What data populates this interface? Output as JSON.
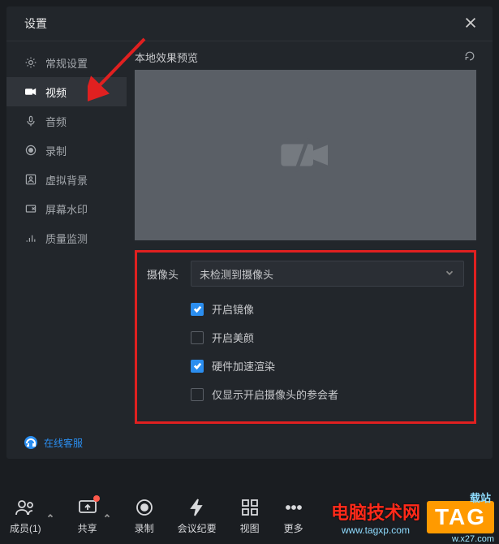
{
  "header": {
    "title": "设置"
  },
  "sidebar": {
    "items": [
      {
        "label": "常规设置"
      },
      {
        "label": "视频"
      },
      {
        "label": "音频"
      },
      {
        "label": "录制"
      },
      {
        "label": "虚拟背景"
      },
      {
        "label": "屏幕水印"
      },
      {
        "label": "质量监测"
      }
    ],
    "support": "在线客服"
  },
  "main": {
    "preview_label": "本地效果预览",
    "camera_label": "摄像头",
    "camera_value": "未检测到摄像头",
    "options": [
      {
        "label": "开启镜像",
        "checked": true
      },
      {
        "label": "开启美颜",
        "checked": false
      },
      {
        "label": "硬件加速渲染",
        "checked": true
      },
      {
        "label": "仅显示开启摄像头的参会者",
        "checked": false
      }
    ]
  },
  "toolbar": {
    "items": [
      {
        "label": "成员(1)"
      },
      {
        "label": "共享"
      },
      {
        "label": "录制"
      },
      {
        "label": "会议纪要"
      },
      {
        "label": "视图"
      },
      {
        "label": "更多"
      }
    ]
  },
  "watermark": {
    "brand": "电脑技术网",
    "site": "www.tagxp.com",
    "tag": "TAG",
    "partial1": "载站",
    "partial2": "w.x27.com"
  }
}
